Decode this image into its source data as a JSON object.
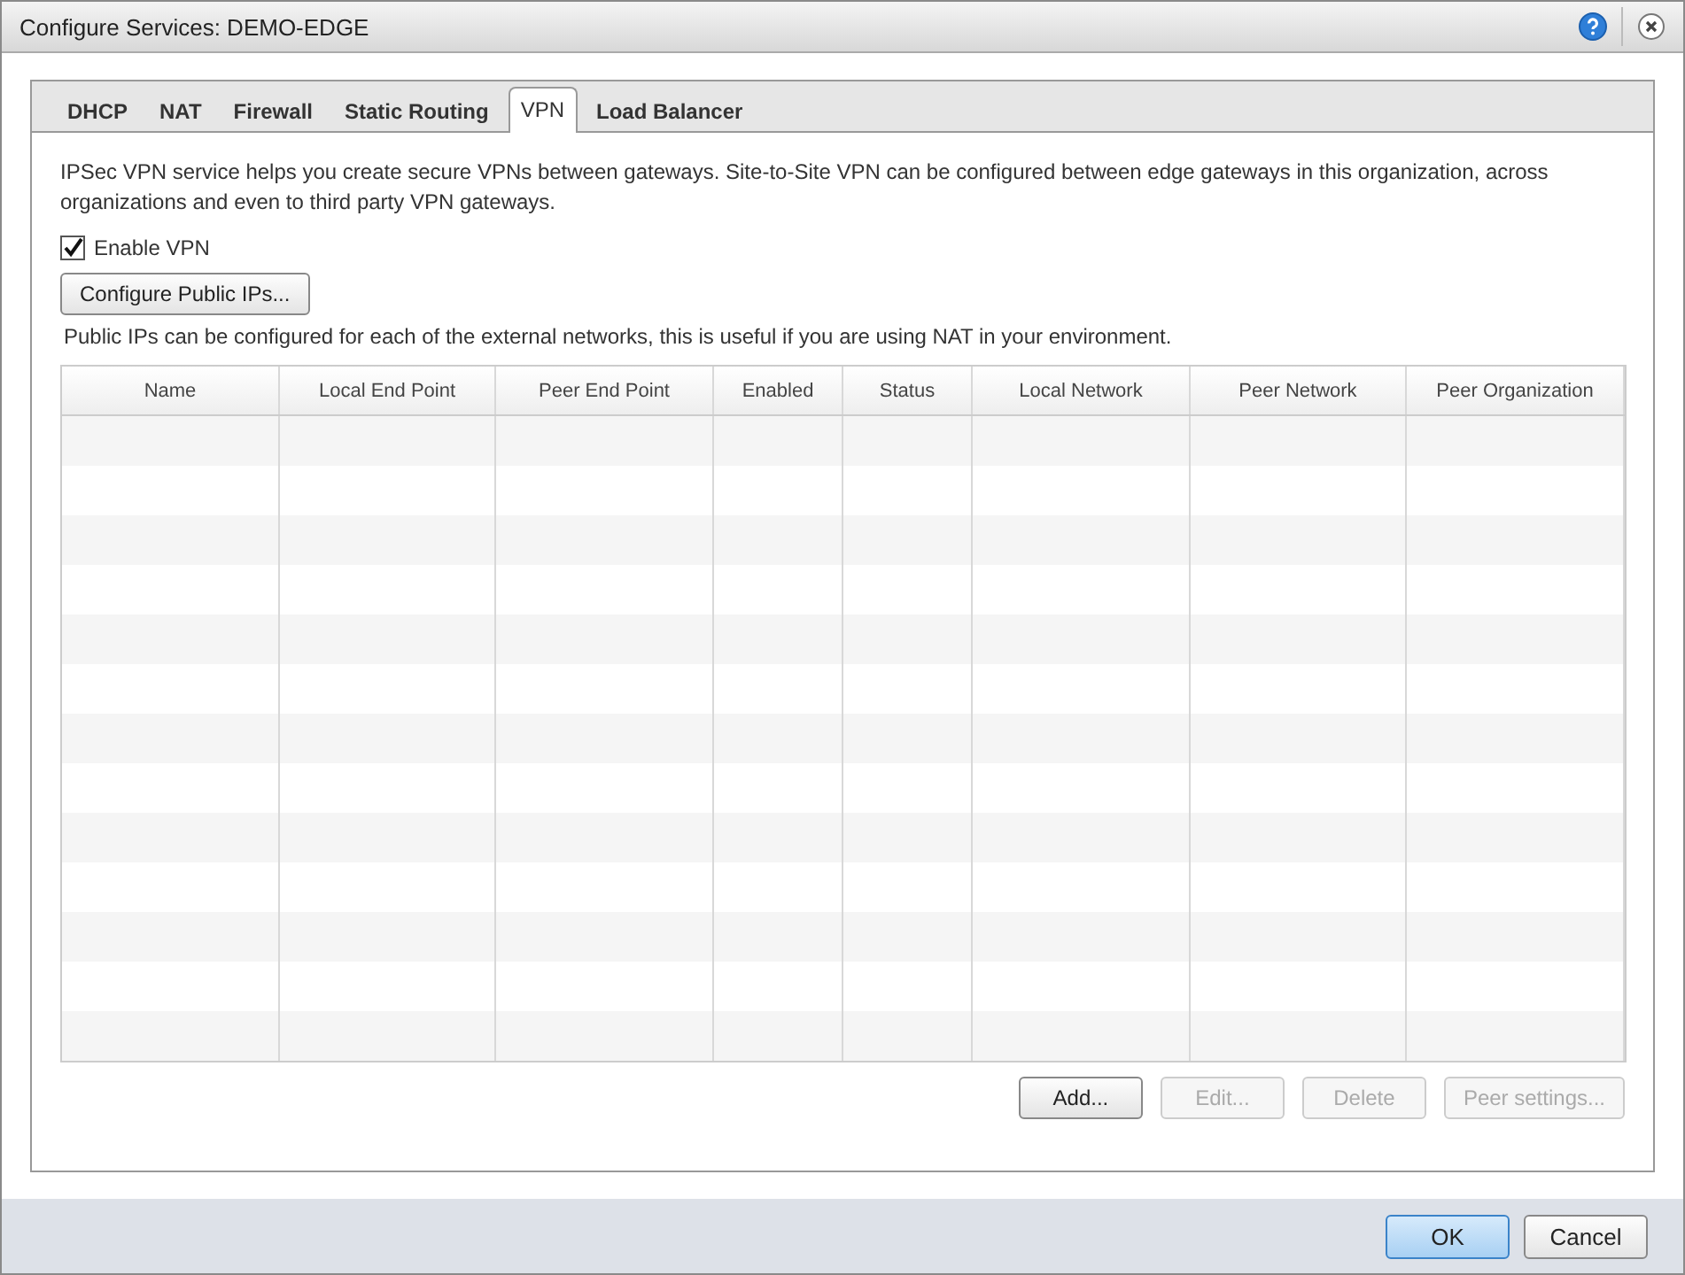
{
  "window": {
    "title": "Configure Services: DEMO-EDGE"
  },
  "tabs": [
    {
      "label": "DHCP",
      "selected": false
    },
    {
      "label": "NAT",
      "selected": false
    },
    {
      "label": "Firewall",
      "selected": false
    },
    {
      "label": "Static Routing",
      "selected": false
    },
    {
      "label": "VPN",
      "selected": true
    },
    {
      "label": "Load Balancer",
      "selected": false
    }
  ],
  "description": "IPSec VPN service helps you create secure VPNs between gateways. Site-to-Site VPN can be configured between edge gateways in this organization, across organizations and even to third party VPN gateways.",
  "enable_vpn": {
    "label": "Enable VPN",
    "checked": true
  },
  "configure_button": "Configure Public IPs...",
  "public_ips_note": "Public IPs can be configured for each of the external networks, this is useful if you are using NAT in your environment.",
  "table": {
    "columns": [
      "Name",
      "Local End Point",
      "Peer End Point",
      "Enabled",
      "Status",
      "Local Network",
      "Peer Network",
      "Peer Organization"
    ]
  },
  "table_buttons": [
    {
      "label": "Add...",
      "disabled": false
    },
    {
      "label": "Edit...",
      "disabled": true
    },
    {
      "label": "Delete",
      "disabled": true
    },
    {
      "label": "Peer settings...",
      "disabled": true
    }
  ],
  "footer_buttons": [
    {
      "label": "OK",
      "kind": "primary"
    },
    {
      "label": "Cancel",
      "kind": "normal"
    }
  ]
}
